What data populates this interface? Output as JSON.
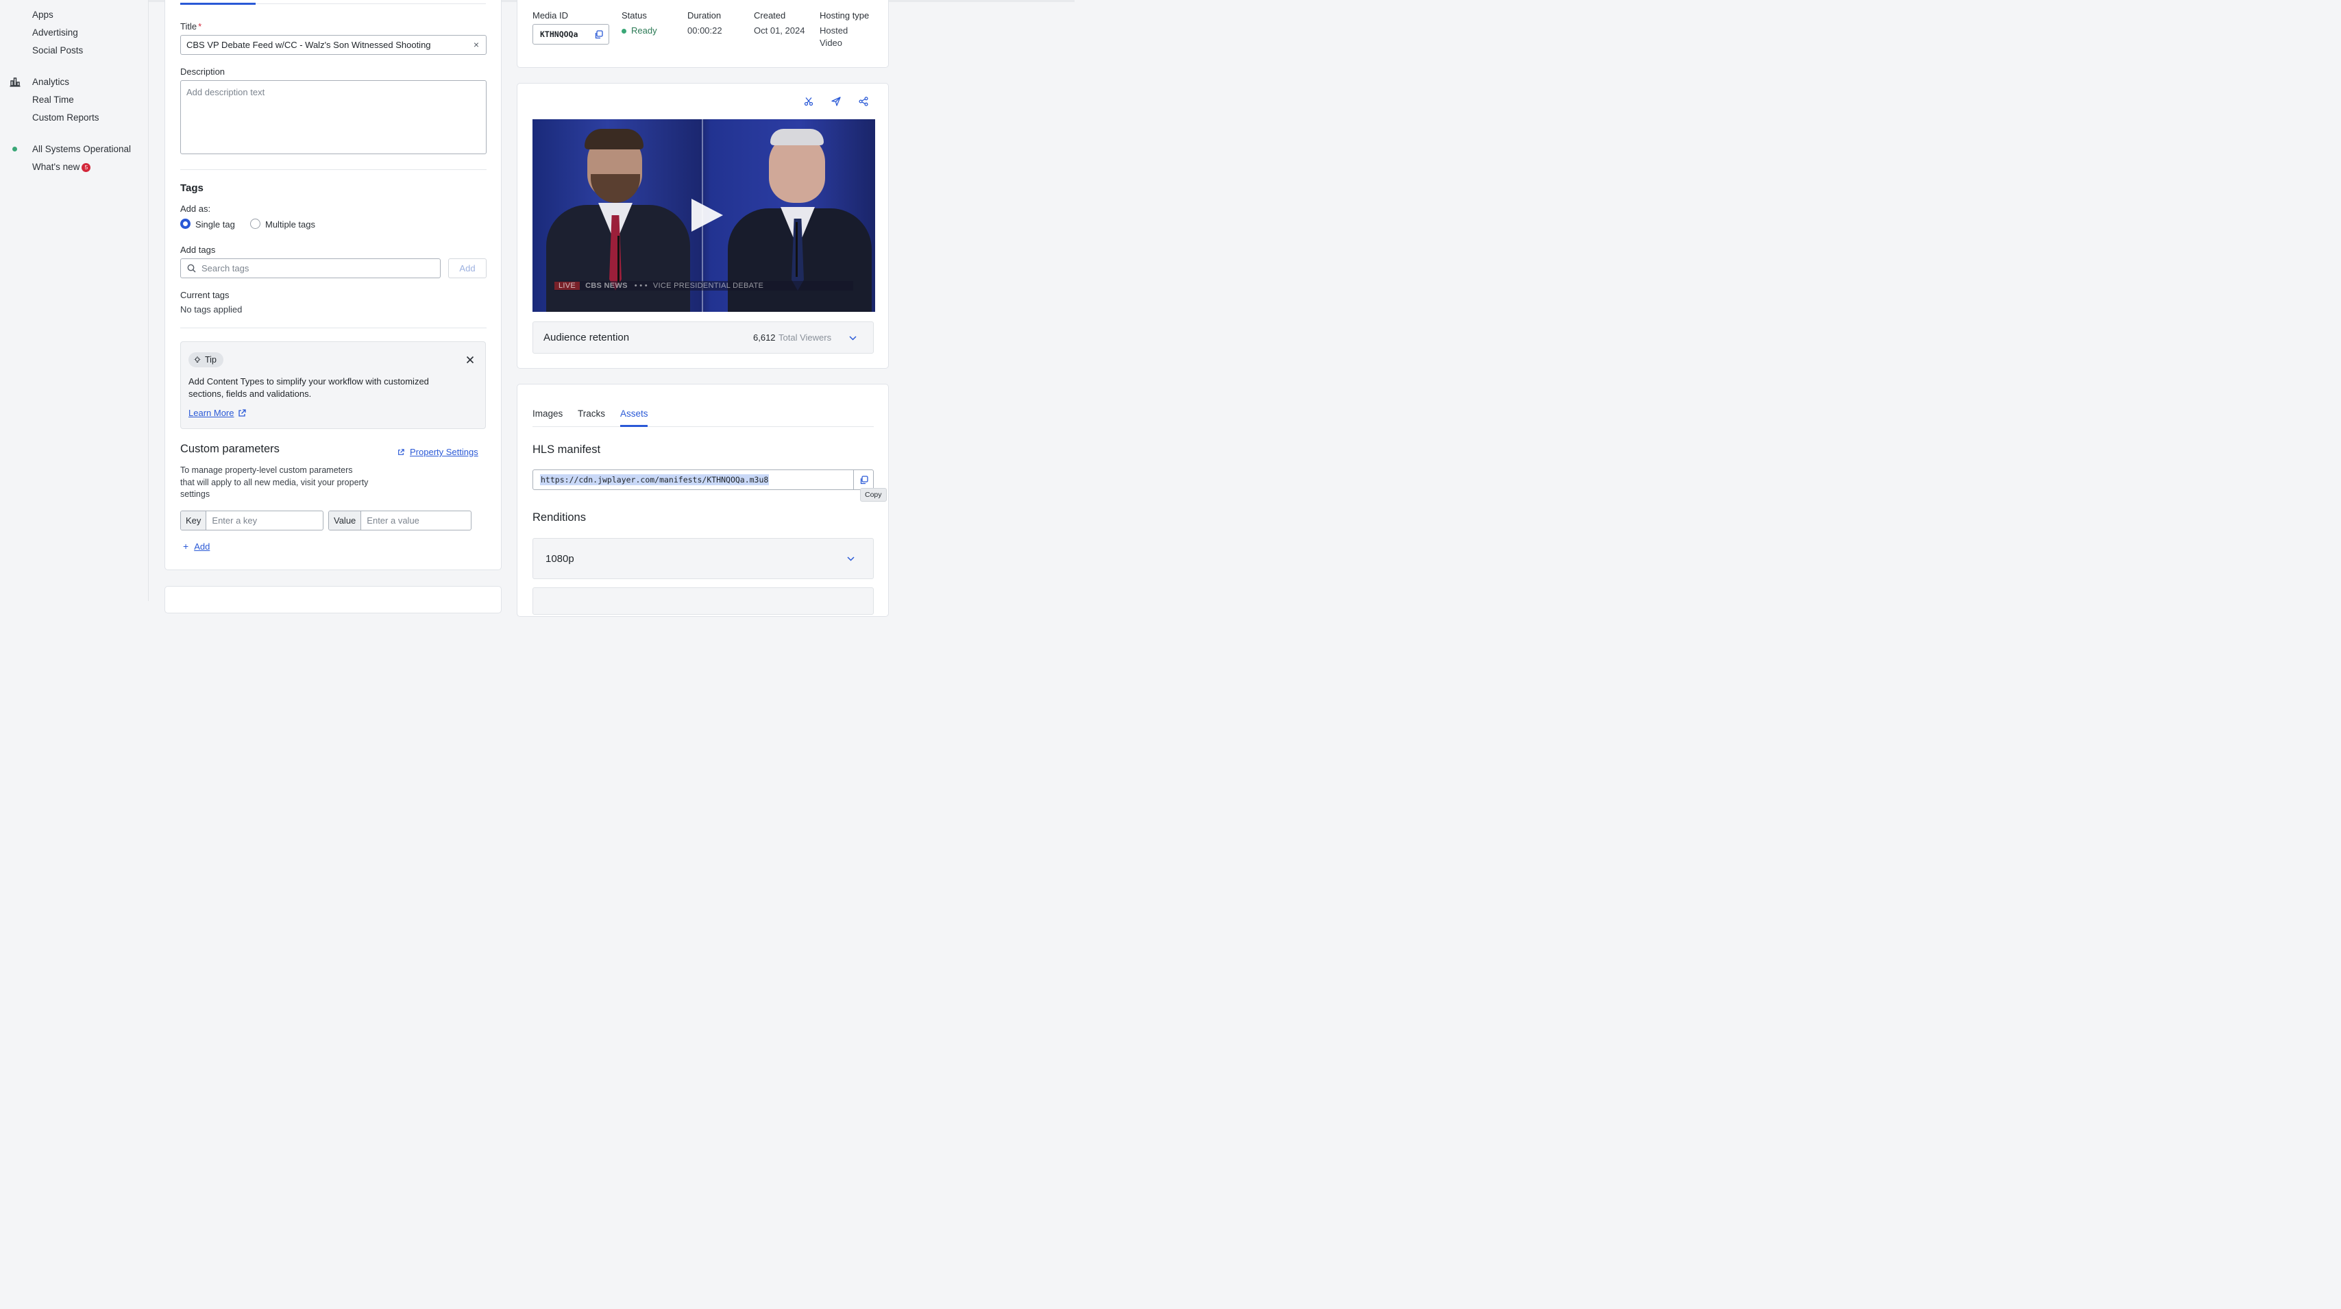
{
  "sidebar": {
    "items": [
      {
        "label": "Apps"
      },
      {
        "label": "Advertising"
      },
      {
        "label": "Social Posts"
      },
      {
        "label": "Analytics"
      },
      {
        "label": "Real Time"
      },
      {
        "label": "Custom Reports"
      },
      {
        "label": "All Systems Operational"
      },
      {
        "label": "What's new"
      }
    ],
    "whats_new_count": "5"
  },
  "details": {
    "title_label": "Title",
    "title_required": "*",
    "title_value": "CBS VP Debate Feed w/CC - Walz's Son Witnessed Shooting",
    "description_label": "Description",
    "description_placeholder": "Add description text",
    "tags_heading": "Tags",
    "add_as_label": "Add as:",
    "radio_single": "Single tag",
    "radio_multiple": "Multiple tags",
    "add_tags_label": "Add tags",
    "search_tags_placeholder": "Search tags",
    "add_button": "Add",
    "current_tags_label": "Current tags",
    "current_tags_value": "No tags applied"
  },
  "tip": {
    "badge": "Tip",
    "text": "Add Content Types to simplify your workflow with customized sections, fields and validations.",
    "link": "Learn More"
  },
  "custom_params": {
    "heading": "Custom parameters",
    "property_link": "Property Settings",
    "description": "To manage property-level custom parameters that will apply to all new media, visit your property settings",
    "key_label": "Key",
    "key_placeholder": "Enter a key",
    "value_label": "Value",
    "value_placeholder": "Enter a value",
    "add_link": "Add"
  },
  "meta": {
    "media_id_label": "Media ID",
    "media_id": "KTHNQOQa",
    "status_label": "Status",
    "status_value": "Ready",
    "duration_label": "Duration",
    "duration_value": "00:00:22",
    "created_label": "Created",
    "created_value": "Oct 01, 2024",
    "hosting_label": "Hosting type",
    "hosting_value_1": "Hosted",
    "hosting_value_2": "Video"
  },
  "player": {
    "lower_third_live": "LIVE",
    "lower_third_network": "CBS NEWS",
    "lower_third_title": "VICE PRESIDENTIAL DEBATE"
  },
  "retention": {
    "title": "Audience retention",
    "viewers": "6,612",
    "viewers_label": "Total Viewers"
  },
  "assets": {
    "tabs": [
      "Images",
      "Tracks",
      "Assets"
    ],
    "active_tab": "Assets",
    "hls_heading": "HLS manifest",
    "hls_url": "https://cdn.jwplayer.com/manifests/KTHNQOQa.m3u8",
    "copy_tooltip": "Copy",
    "renditions_heading": "Renditions",
    "rendition_1": "1080p"
  },
  "colors": {
    "accent": "#2a59d6",
    "status_ready": "#3aa777",
    "required": "#d3283b"
  }
}
